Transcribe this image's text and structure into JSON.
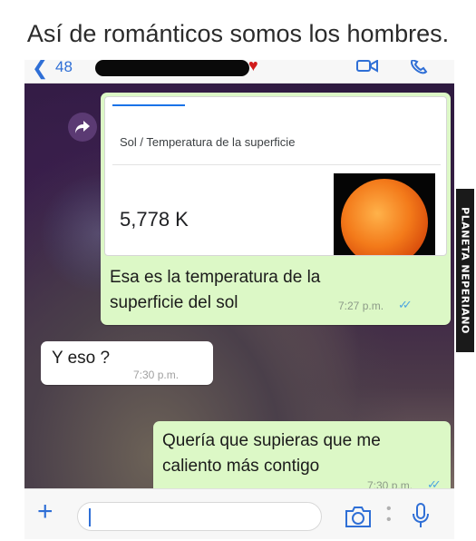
{
  "caption": "Así de románticos somos los hombres.",
  "header": {
    "back_count": "48",
    "video_icon": "video-call-icon",
    "phone_icon": "phone-call-icon"
  },
  "messages": {
    "shared_card": {
      "breadcrumb": "Sol / Temperatura de la superficie",
      "value": "5,778 K",
      "image": "sun-image",
      "text": "Esa es la temperatura de la superficie del sol",
      "time": "7:27 p.m."
    },
    "incoming": {
      "text": "Y eso ?",
      "time": "7:30 p.m."
    },
    "outgoing": {
      "text": "Quería que supieras que me caliento más contigo",
      "time": "7:30 p.m."
    }
  },
  "input": {
    "value": ""
  },
  "watermark": "PLANETA NEPERIANO",
  "colors": {
    "outgoing_bubble": "#dcf8c6",
    "incoming_bubble": "#ffffff",
    "accent": "#2f6fd6",
    "read_ticks": "#4fa6e0"
  }
}
